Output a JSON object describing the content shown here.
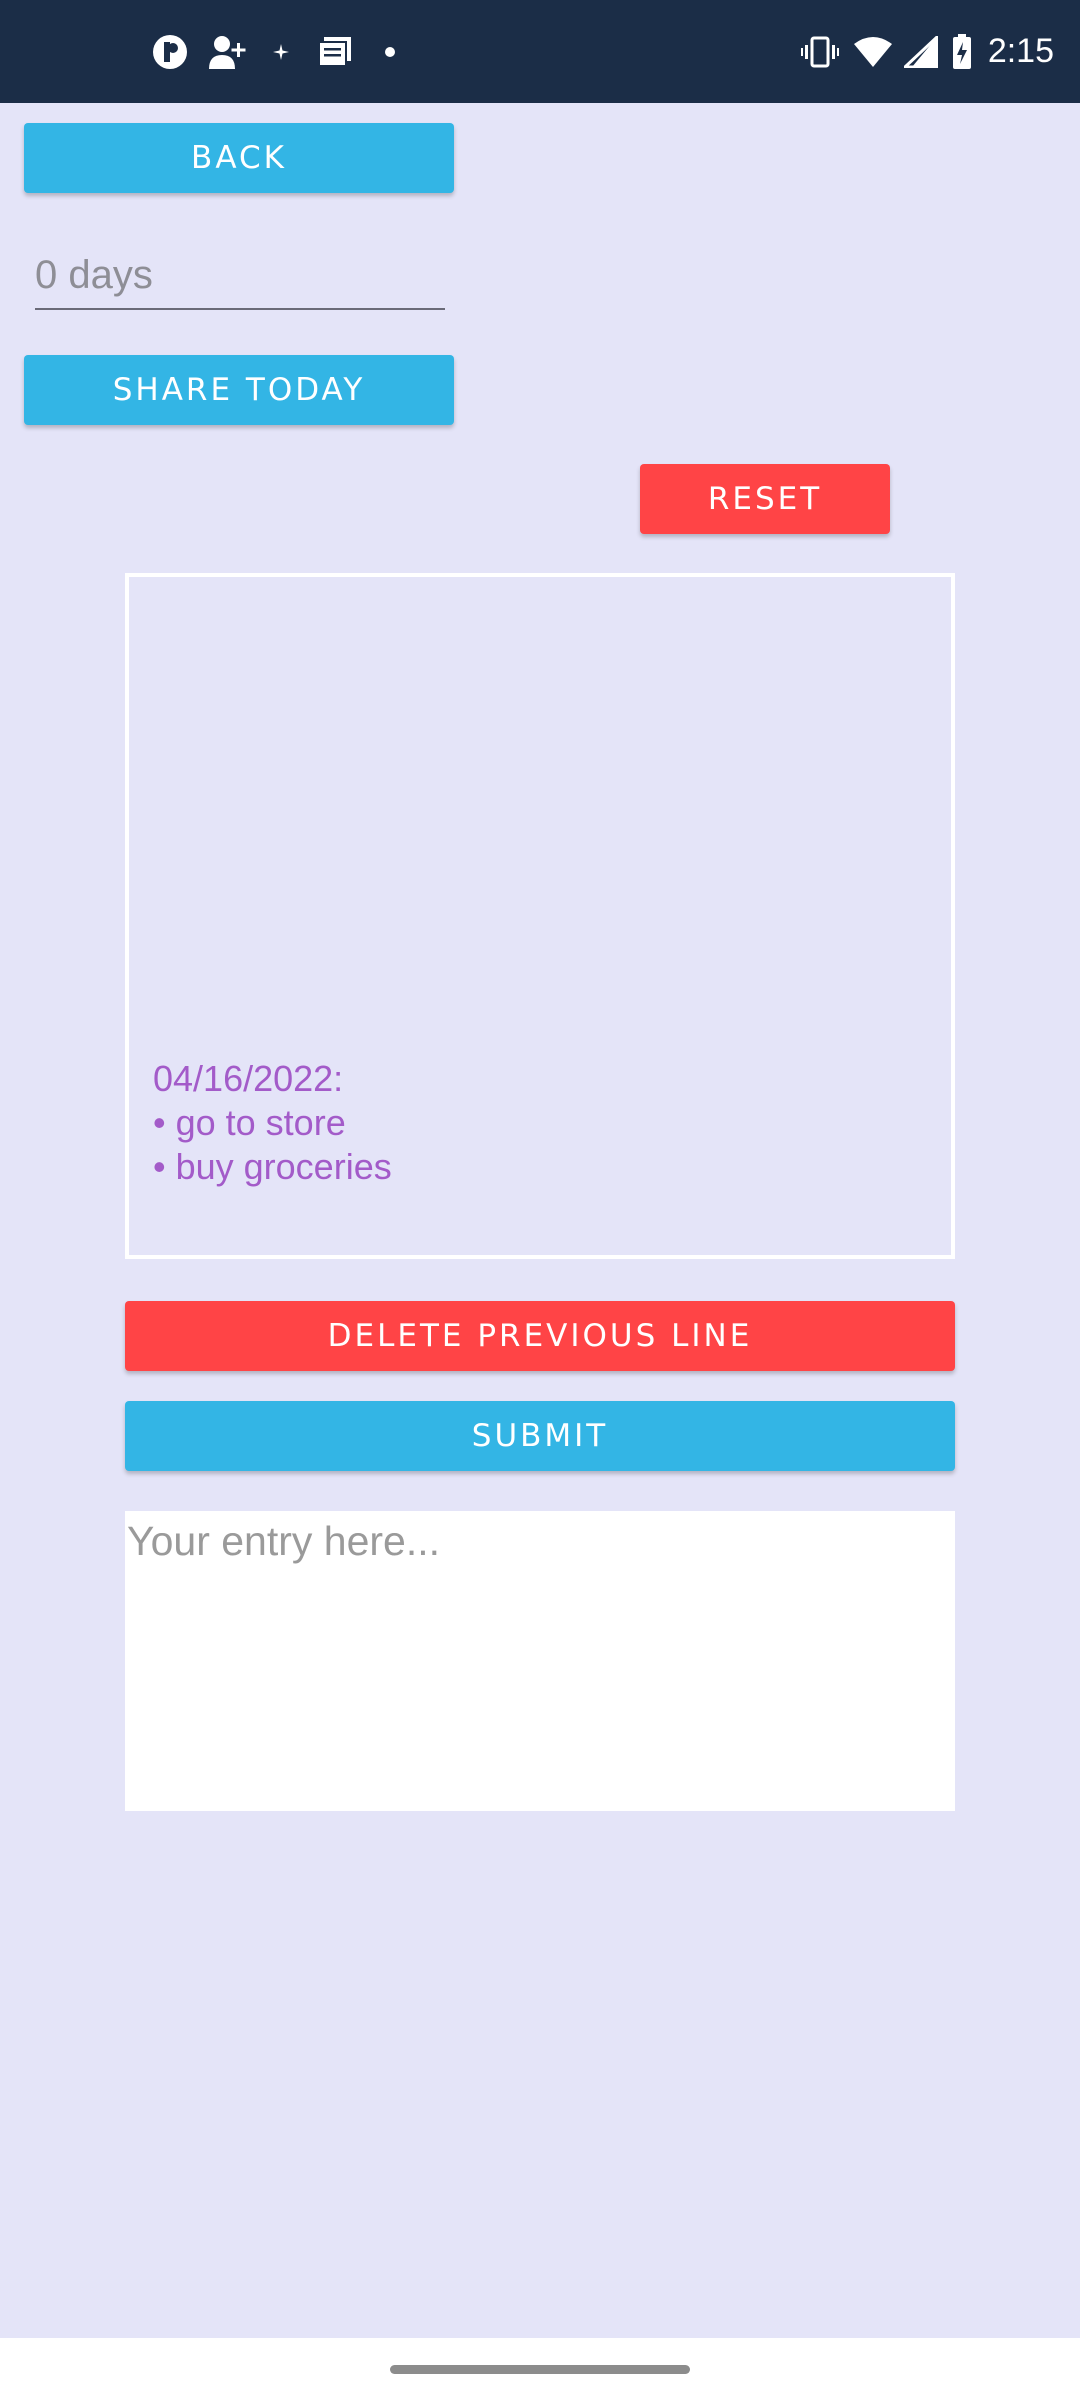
{
  "status_bar": {
    "time": "2:15",
    "left_icons": [
      "p-app-icon",
      "add-contact-icon",
      "sparkle-icon",
      "message-icon",
      "dot-icon"
    ],
    "right_icons": [
      "vibrate-icon",
      "wifi-icon",
      "cell-signal-icon",
      "battery-charging-icon"
    ]
  },
  "toolbar": {
    "back_label": "BACK",
    "share_today_label": "SHARE TODAY",
    "reset_label": "RESET"
  },
  "days_field": {
    "value": "0 days"
  },
  "journal": {
    "lines": [
      "04/16/2022:",
      "• go to store",
      "• buy groceries"
    ]
  },
  "actions": {
    "delete_previous_line_label": "DELETE PREVIOUS LINE",
    "submit_label": "SUBMIT"
  },
  "entry": {
    "placeholder": "Your entry here..."
  },
  "colors": {
    "background": "#e4e4f8",
    "status_bar": "#1b2d47",
    "blue_button": "#33b5e5",
    "red_button": "#ff4446",
    "journal_text": "#a35bc9"
  }
}
